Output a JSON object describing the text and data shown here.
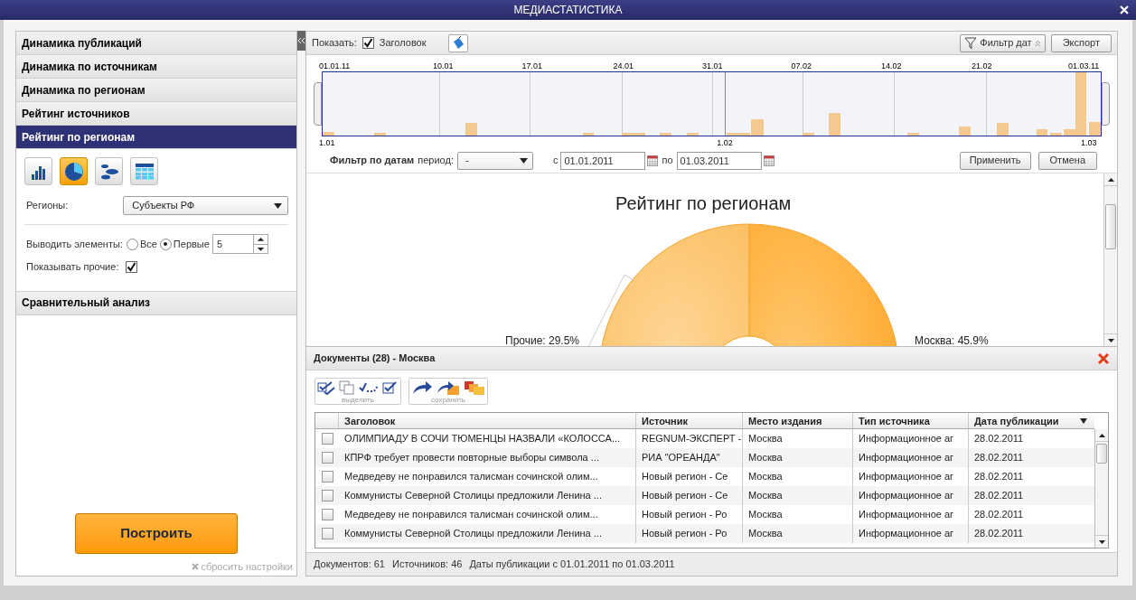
{
  "window": {
    "title": "МЕДИАСТАТИСТИКА"
  },
  "sidebar": {
    "sections": [
      {
        "label": "Динамика публикаций",
        "selected": false
      },
      {
        "label": "Динамика по источникам",
        "selected": false
      },
      {
        "label": "Динамика по регионам",
        "selected": false
      },
      {
        "label": "Рейтинг источников",
        "selected": false
      },
      {
        "label": "Рейтинг по регионам",
        "selected": true
      },
      {
        "label": "Сравнительный анализ",
        "selected": false
      }
    ],
    "chart_types": [
      {
        "kind": "bar",
        "selected": false
      },
      {
        "kind": "pie",
        "selected": true
      },
      {
        "kind": "bubbles",
        "selected": false
      },
      {
        "kind": "table",
        "selected": false
      }
    ],
    "regions": {
      "label": "Регионы:",
      "value": "Субъекты РФ"
    },
    "output": {
      "label": "Выводить элементы:",
      "options": [
        {
          "label": "Все",
          "selected": false
        },
        {
          "label": "Первые",
          "selected": true
        }
      ],
      "count": "5"
    },
    "show_other": {
      "label": "Показывать прочие:",
      "checked": true
    },
    "build_button": "Построить",
    "reset_link": "сбросить настройки"
  },
  "toolbar": {
    "show_label": "Показать:",
    "header_toggle": {
      "label": "Заголовок",
      "checked": true
    },
    "date_filter_button": "Фильтр дат",
    "export_button": "Экспорт"
  },
  "timeline": {
    "top_labels": [
      "01.01.11",
      "10.01",
      "17.01",
      "24.01",
      "31.01",
      "07.02",
      "14.02",
      "21.02",
      "01.03.11"
    ],
    "bottom_labels": [
      "1.01",
      "1.02",
      "1.03"
    ]
  },
  "date_filter": {
    "label": "Фильтр по датам",
    "period_label": "период:",
    "period_value": "-",
    "from_label": "с",
    "from_value": "01.01.2011",
    "to_label": "по",
    "to_value": "01.03.2011",
    "apply_button": "Применить",
    "cancel_button": "Отмена"
  },
  "chart": {
    "title": "Рейтинг по регионам",
    "chart_data": {
      "type": "donut",
      "values": [
        45.9,
        29.5
      ],
      "value_labels": [
        "Москва: 45.9%",
        "Прочие: 29.5%"
      ]
    }
  },
  "documents": {
    "title": "Документы (28) - Москва",
    "select_group_label": "выделить",
    "save_group_label": "сохранить",
    "columns": [
      "Заголовок",
      "Источник",
      "Место издания",
      "Тип источника",
      "Дата публикации"
    ],
    "rows": [
      {
        "checked": false,
        "title": "ОЛИМПИАДУ В СОЧИ ТЮМЕНЦЫ НАЗВАЛИ «КОЛОССА...",
        "source": "REGNUM-ЭКСПЕРТ -",
        "place": "Москва",
        "type": "Информационное аг",
        "date": "28.02.2011"
      },
      {
        "checked": false,
        "title": "КПРФ требует провести повторные выборы символа ...",
        "source": "РИА \"ОРЕАНДА\"",
        "place": "Москва",
        "type": "Информационное аг",
        "date": "28.02.2011"
      },
      {
        "checked": false,
        "title": "Медведеву не понравился талисман сочинской олим...",
        "source": "Новый регион - Се",
        "place": "Москва",
        "type": "Информационное аг",
        "date": "28.02.2011"
      },
      {
        "checked": false,
        "title": "Коммунисты Северной Столицы предложили Ленина ...",
        "source": "Новый регион - Се",
        "place": "Москва",
        "type": "Информационное аг",
        "date": "28.02.2011"
      },
      {
        "checked": false,
        "title": "Медведеву не понравился талисман сочинской олим...",
        "source": "Новый регион - Ро",
        "place": "Москва",
        "type": "Информационное аг",
        "date": "28.02.2011"
      },
      {
        "checked": false,
        "title": "Коммунисты Северной Столицы предложили Ленина ...",
        "source": "Новый регион - Ро",
        "place": "Москва",
        "type": "Информационное аг",
        "date": "28.02.2011"
      }
    ]
  },
  "status_bar": {
    "documents": "Документов: 61",
    "sources": "Источников: 46",
    "dates": "Даты публикации с 01.01.2011 по 01.03.2011"
  }
}
